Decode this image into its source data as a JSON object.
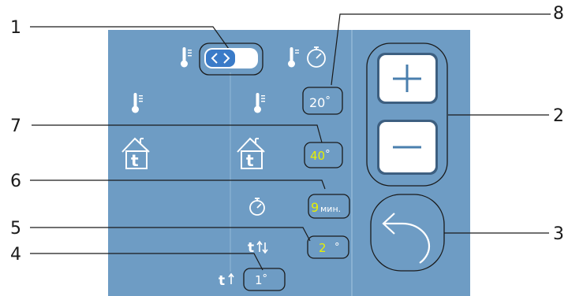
{
  "colors": {
    "panel": "#6e9cc4",
    "panel_divider": "#93b8d6",
    "icon_white": "#ffffff",
    "accent_yellow": "#e8f000",
    "outline_dark": "#1a1a1a",
    "toggle_blue": "#3a7bc8"
  },
  "callouts": [
    "1",
    "2",
    "3",
    "4",
    "5",
    "6",
    "7",
    "8"
  ],
  "settings": {
    "room_temp": {
      "value": "20",
      "unit": "°"
    },
    "house_temp": {
      "value": "40",
      "unit": "°"
    },
    "timer": {
      "value": "9",
      "unit": "мин."
    },
    "hysteresis_up_down": {
      "value": "2",
      "unit": "°"
    },
    "hysteresis_up": {
      "value": "1",
      "unit": "°"
    }
  },
  "labels": {
    "t_up_down": "t",
    "t_up": "t",
    "house_letter": "t"
  },
  "icons": {
    "toggle_icon": "chevron-left-right-icon",
    "thermometer": "thermometer-icon",
    "thermometer_timer": "thermometer-timer-icon",
    "house": "house-thermometer-icon",
    "timer": "stopwatch-icon",
    "plus": "plus-icon",
    "minus": "minus-icon",
    "back": "back-arrow-icon"
  }
}
